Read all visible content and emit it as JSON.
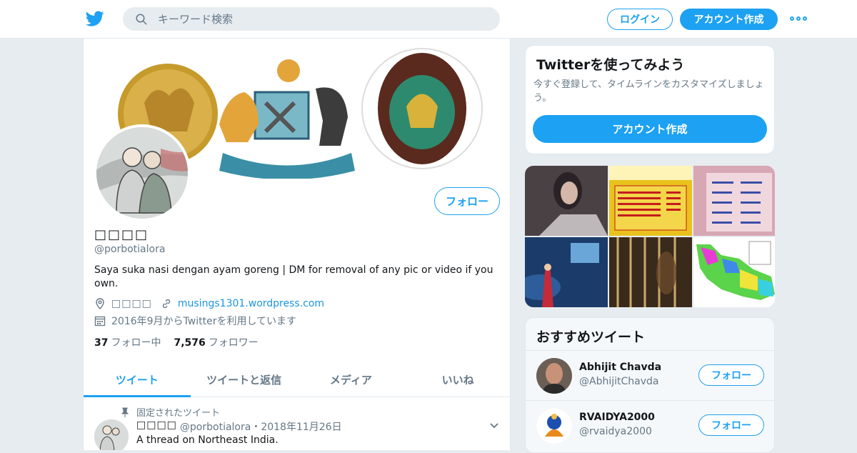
{
  "colors": {
    "accent": "#1da1f2",
    "bg": "#e6ecf0",
    "muted": "#657786",
    "link": "#1b95e0"
  },
  "header": {
    "search_placeholder": "キーワード検索",
    "login_label": "ログイン",
    "signup_label": "アカウント作成"
  },
  "profile": {
    "name": "□□□□",
    "handle": "@porbotialora",
    "follow_label": "フォロー",
    "bio": "Saya suka nasi dengan ayam goreng | DM for removal of any pic or video if you own.",
    "location": "□□□□",
    "website": "musings1301.wordpress.com",
    "joined": "2016年9月からTwitterを利用しています",
    "following_count": "37",
    "following_label": "フォロー中",
    "followers_count": "7,576",
    "followers_label": "フォロワー"
  },
  "tabs": [
    {
      "label": "ツイート"
    },
    {
      "label": "ツイートと返信"
    },
    {
      "label": "メディア"
    },
    {
      "label": "いいね"
    }
  ],
  "pinned_tweet": {
    "pinned_label": "固定されたツイート",
    "name": "□□□□",
    "meta": "@porbotialora・2018年11月26日",
    "text": "A thread on Northeast India."
  },
  "sidebar": {
    "try": {
      "title": "Twitterを使ってみよう",
      "desc": "今すぐ登録して、タイムラインをカスタマイズしましょう。",
      "button": "アカウント作成"
    },
    "recommended": {
      "title": "おすすめツイート",
      "accounts": [
        {
          "name": "Abhijit Chavda",
          "handle": "@AbhijitChavda",
          "button": "フォロー"
        },
        {
          "name": "RVAIDYA2000",
          "handle": "@rvaidya2000",
          "button": "フォロー"
        }
      ]
    }
  }
}
